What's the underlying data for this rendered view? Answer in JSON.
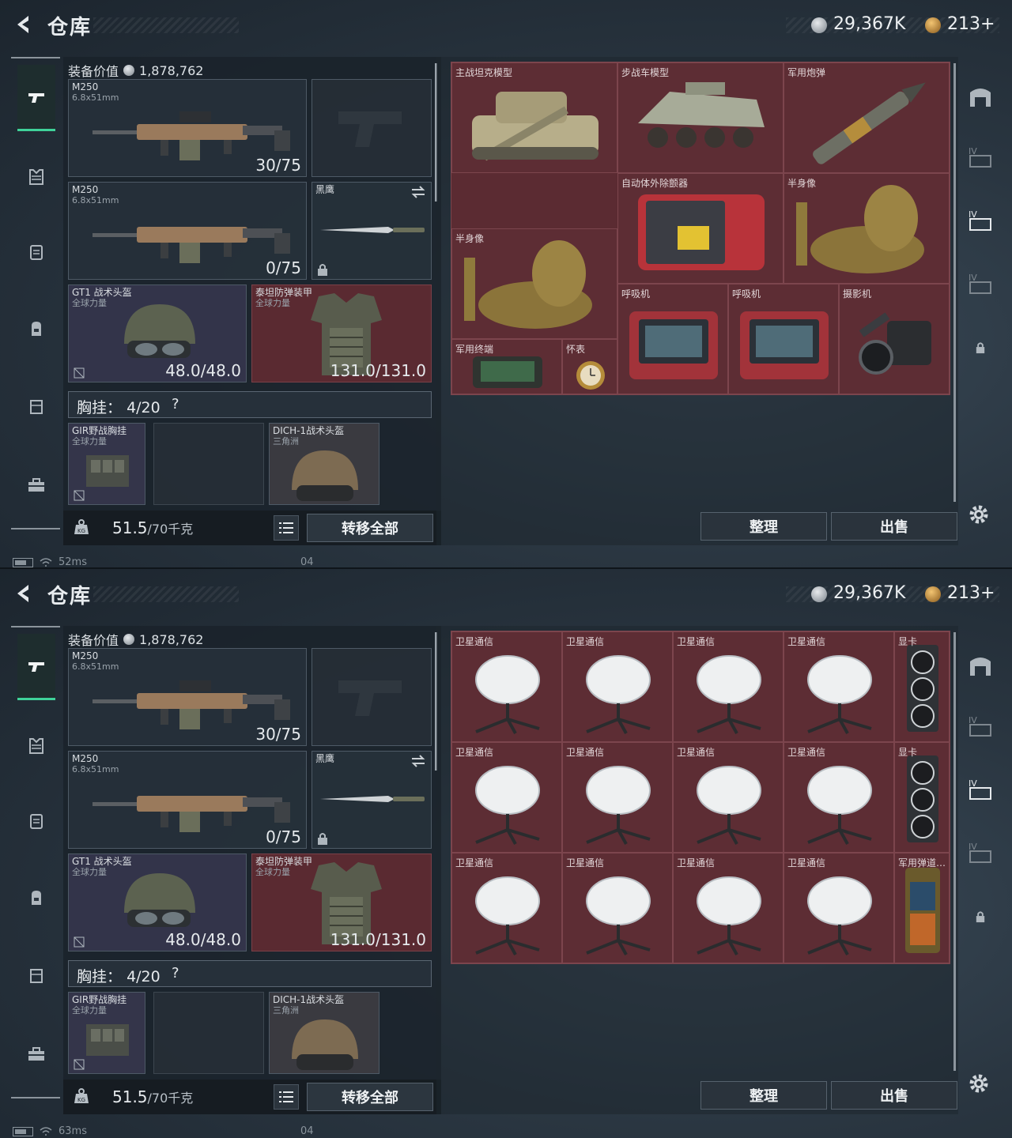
{
  "screens": [
    {
      "title": "仓库",
      "currency": {
        "silver": "29,367K",
        "gold": "213+"
      },
      "equip_value_label": "装备价值",
      "equip_value": "1,878,762",
      "primary_weapon": {
        "name": "M250",
        "caliber": "6.8x51mm",
        "ammo": "30/75"
      },
      "secondary_weapon": {
        "name": "M250",
        "caliber": "6.8x51mm",
        "ammo": "0/75"
      },
      "melee": {
        "name": "黑鹰"
      },
      "helmet": {
        "name": "GT1 战术头盔",
        "sub": "全球力量",
        "durability": "48.0/48.0"
      },
      "armor": {
        "name": "泰坦防弹装甲",
        "sub": "全球力量",
        "durability": "131.0/131.0"
      },
      "chest_rig": {
        "label": "胸挂：",
        "value": "4/20",
        "help": "?"
      },
      "rig_item": {
        "name": "GIR野战胸挂",
        "sub": "全球力量"
      },
      "bag_item": {
        "name": "DICH-1战术头盔",
        "sub": "三角洲"
      },
      "weight": {
        "current": "51.5",
        "max": "/70千克"
      },
      "kg_label": "KG",
      "transfer_label": "转移全部",
      "sort_label": "整理",
      "sell_label": "出售",
      "status": {
        "ping": "52ms",
        "code": "04"
      },
      "storage": [
        {
          "label": "主战坦克模型",
          "art": "tank"
        },
        {
          "label": "步战车模型",
          "art": "ifv"
        },
        {
          "label": "军用炮弹",
          "art": "shell"
        },
        {
          "label": "自动体外除颤器",
          "art": "aed"
        },
        {
          "label": "半身像",
          "art": "bust"
        },
        {
          "label": "半身像",
          "art": "bust"
        },
        {
          "label": "呼吸机",
          "art": "vent"
        },
        {
          "label": "呼吸机",
          "art": "vent"
        },
        {
          "label": "摄影机",
          "art": "camera"
        },
        {
          "label": "军用终端",
          "art": "terminal"
        },
        {
          "label": "怀表",
          "art": "watch"
        }
      ]
    },
    {
      "title": "仓库",
      "currency": {
        "silver": "29,367K",
        "gold": "213+"
      },
      "equip_value_label": "装备价值",
      "equip_value": "1,878,762",
      "primary_weapon": {
        "name": "M250",
        "caliber": "6.8x51mm",
        "ammo": "30/75"
      },
      "secondary_weapon": {
        "name": "M250",
        "caliber": "6.8x51mm",
        "ammo": "0/75"
      },
      "melee": {
        "name": "黑鹰"
      },
      "helmet": {
        "name": "GT1 战术头盔",
        "sub": "全球力量",
        "durability": "48.0/48.0"
      },
      "armor": {
        "name": "泰坦防弹装甲",
        "sub": "全球力量",
        "durability": "131.0/131.0"
      },
      "chest_rig": {
        "label": "胸挂：",
        "value": "4/20",
        "help": "?"
      },
      "rig_item": {
        "name": "GIR野战胸挂",
        "sub": "全球力量"
      },
      "bag_item": {
        "name": "DICH-1战术头盔",
        "sub": "三角洲"
      },
      "weight": {
        "current": "51.5",
        "max": "/70千克"
      },
      "kg_label": "KG",
      "transfer_label": "转移全部",
      "sort_label": "整理",
      "sell_label": "出售",
      "status": {
        "ping": "63ms",
        "code": "04"
      },
      "storage": [
        {
          "label": "卫星通信",
          "art": "dish"
        },
        {
          "label": "卫星通信",
          "art": "dish"
        },
        {
          "label": "卫星通信",
          "art": "dish"
        },
        {
          "label": "卫星通信",
          "art": "dish"
        },
        {
          "label": "显卡",
          "art": "gpu"
        },
        {
          "label": "卫星通信",
          "art": "dish"
        },
        {
          "label": "卫星通信",
          "art": "dish"
        },
        {
          "label": "卫星通信",
          "art": "dish"
        },
        {
          "label": "卫星通信",
          "art": "dish"
        },
        {
          "label": "显卡",
          "art": "gpu"
        },
        {
          "label": "卫星通信",
          "art": "dish"
        },
        {
          "label": "卫星通信",
          "art": "dish"
        },
        {
          "label": "卫星通信",
          "art": "dish"
        },
        {
          "label": "卫星通信",
          "art": "dish"
        },
        {
          "label": "军用弹道…",
          "art": "ballistic"
        }
      ]
    }
  ],
  "colors": {
    "accent": "#3fd29a",
    "storage_bg": "#5b2b32",
    "panel_bg": "#1a222a"
  },
  "icons": [
    "back-icon",
    "silver-coin-icon",
    "gold-coin-icon",
    "pistol-icon",
    "armor-icon",
    "rig-icon",
    "backpack-icon",
    "case-icon",
    "toolbox-icon",
    "lock-icon",
    "swap-icon",
    "kg-icon",
    "list-icon",
    "gear-icon",
    "safe-icon",
    "floor-icon"
  ]
}
